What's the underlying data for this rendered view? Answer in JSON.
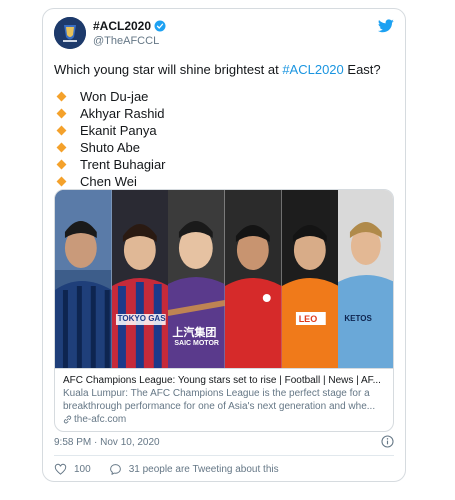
{
  "account": {
    "display_name": "#ACL2020",
    "handle": "@TheAFCCL"
  },
  "tweet": {
    "text_before": "Which young star will shine brightest at ",
    "hashtag": "#ACL2020",
    "text_after": " East?",
    "names": [
      "Won Du-jae",
      "Akhyar Rashid",
      "Ekanit Panya",
      "Shuto Abe",
      "Trent Buhagiar",
      "Chen Wei"
    ]
  },
  "link_card": {
    "title": "AFC Champions League: Young stars set to rise | Football | News | AF...",
    "description": "Kuala Lumpur: The AFC Champions League is the perfect stage for a breakthrough performance for one of Asia's next generation and whe...",
    "domain": "the-afc.com",
    "photo_texts": [
      "TOKYO GAS",
      "上汽集团",
      "SAIC MOTOR",
      "LEO",
      "KETOS"
    ]
  },
  "footer": {
    "timestamp": "9:58 PM · Nov 10, 2020",
    "likes": "100",
    "tweeting_about": "31 people are Tweeting about this"
  },
  "colors": {
    "link_blue": "#1b95e0",
    "bullet_orange": "#f4a12b",
    "twitter_blue": "#1da1f2"
  },
  "icons": [
    "avatar-logo",
    "verified-badge-icon",
    "twitter-bird-icon",
    "diamond-bullet-icon",
    "link-icon",
    "info-icon",
    "heart-icon",
    "people-icon"
  ]
}
